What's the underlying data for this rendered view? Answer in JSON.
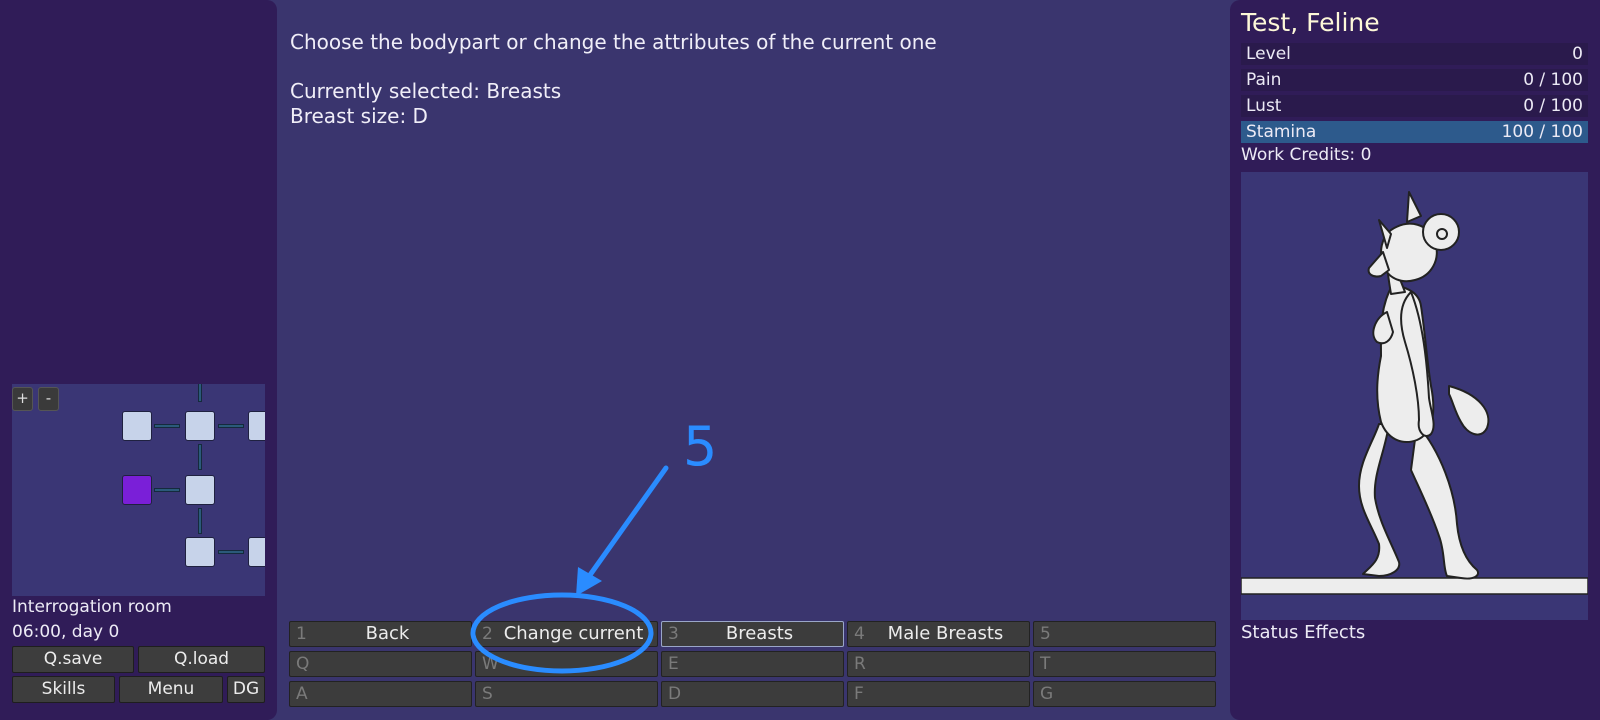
{
  "location": {
    "name": "Interrogation room",
    "time": "06:00, day 0"
  },
  "minimap": {
    "zoom_in": "+",
    "zoom_out": "-"
  },
  "side_buttons": {
    "qsave": "Q.save",
    "qload": "Q.load",
    "skills": "Skills",
    "menu": "Menu",
    "dg": "DG"
  },
  "main": {
    "prompt": "Choose the bodypart or change the attributes of the current one",
    "selected": "Currently selected: Breasts",
    "breast_size": "Breast size: D"
  },
  "actions": [
    {
      "key": "1",
      "label": "Back"
    },
    {
      "key": "2",
      "label": "Change current"
    },
    {
      "key": "3",
      "label": "Breasts"
    },
    {
      "key": "4",
      "label": "Male Breasts"
    },
    {
      "key": "5",
      "label": ""
    },
    {
      "key": "Q",
      "label": ""
    },
    {
      "key": "W",
      "label": ""
    },
    {
      "key": "E",
      "label": ""
    },
    {
      "key": "R",
      "label": ""
    },
    {
      "key": "T",
      "label": ""
    },
    {
      "key": "A",
      "label": ""
    },
    {
      "key": "S",
      "label": ""
    },
    {
      "key": "D",
      "label": ""
    },
    {
      "key": "F",
      "label": ""
    },
    {
      "key": "G",
      "label": ""
    }
  ],
  "annotation": {
    "number": "5",
    "color": "#2a8cff"
  },
  "character": {
    "name": "Test, Feline",
    "stats": [
      {
        "name": "Level",
        "value": "0"
      },
      {
        "name": "Pain",
        "value": "0 / 100"
      },
      {
        "name": "Lust",
        "value": "0 / 100"
      },
      {
        "name": "Stamina",
        "value": "100 / 100"
      }
    ],
    "work_credits": "Work Credits: 0",
    "status_effects": "Status Effects"
  }
}
